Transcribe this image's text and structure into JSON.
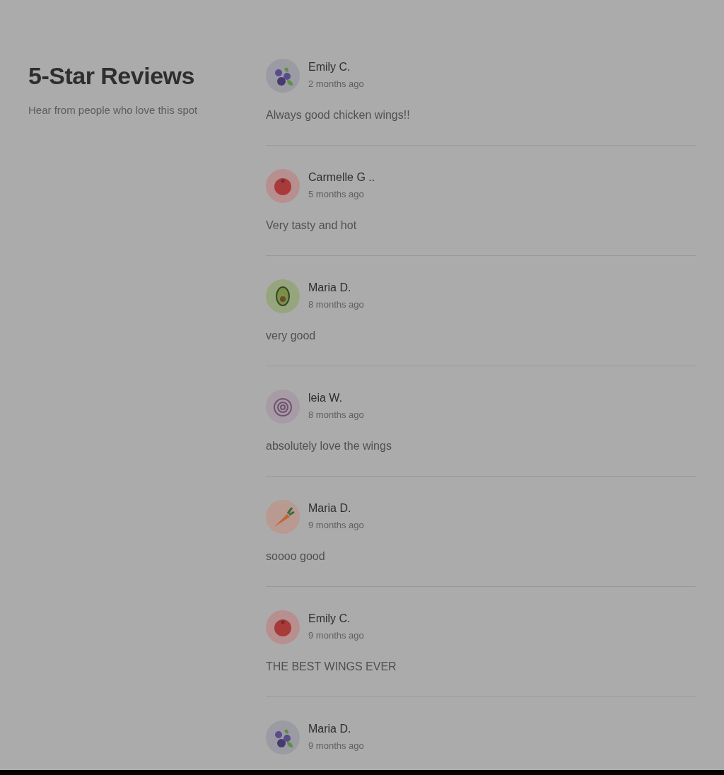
{
  "header": {
    "title": "5-Star Reviews",
    "subtitle": "Hear from people who love this spot"
  },
  "reviews": [
    {
      "name": "Emily C.",
      "time": "2 months ago",
      "text": "Always good chicken wings!!",
      "kind": "blueberry"
    },
    {
      "name": "Carmelle G ..",
      "time": "5 months ago",
      "text": "Very tasty and hot",
      "kind": "tomato"
    },
    {
      "name": "Maria D.",
      "time": "8 months ago",
      "text": "very good",
      "kind": "avocado"
    },
    {
      "name": "leia W.",
      "time": "8 months ago",
      "text": "absolutely love the wings",
      "kind": "onion"
    },
    {
      "name": "Maria D.",
      "time": "9 months ago",
      "text": "soooo good",
      "kind": "carrot"
    },
    {
      "name": "Emily C.",
      "time": "9 months ago",
      "text": "THE BEST WINGS EVER",
      "kind": "tomato"
    },
    {
      "name": "Maria D.",
      "time": "9 months ago",
      "kind": "blueberry"
    }
  ]
}
